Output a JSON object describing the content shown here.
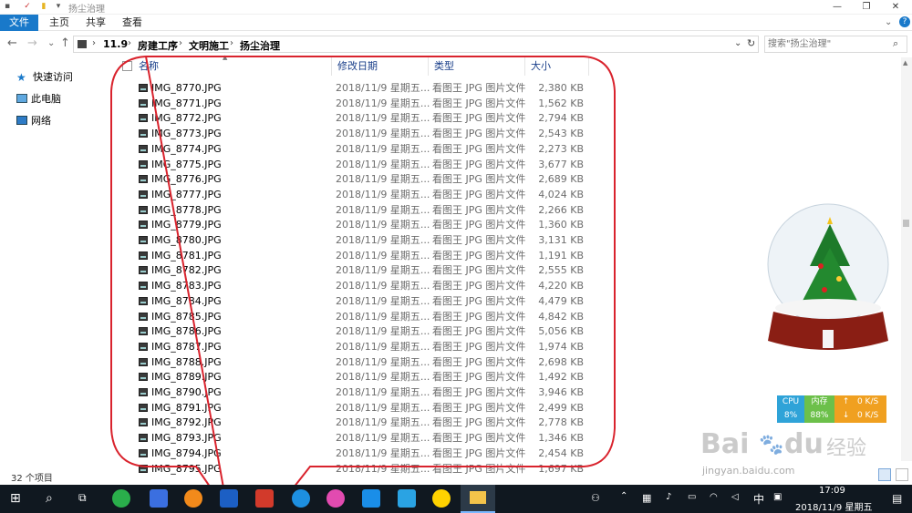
{
  "window": {
    "title": "扬尘治理",
    "minimize_glyph": "—",
    "maximize_glyph": "❐",
    "close_glyph": "✕"
  },
  "ribbon": {
    "file_label": "文件",
    "tabs": [
      "主页",
      "共享",
      "查看"
    ],
    "help_glyph": "?"
  },
  "address": {
    "crumbs": [
      "11.9",
      "房建工序",
      "文明施工",
      "扬尘治理"
    ],
    "search_placeholder": "搜索\"扬尘治理\""
  },
  "nav_pane": {
    "items": [
      {
        "label": "快速访问",
        "icon": "star-icon"
      },
      {
        "label": "此电脑",
        "icon": "computer-icon"
      },
      {
        "label": "网络",
        "icon": "network-icon"
      }
    ]
  },
  "columns": {
    "name": "名称",
    "date": "修改日期",
    "type": "类型",
    "size": "大小"
  },
  "files": [
    {
      "name": "IMG_8770.JPG",
      "date": "2018/11/9 星期五...",
      "type": "看图王 JPG 图片文件",
      "size": "2,380 KB"
    },
    {
      "name": "IMG_8771.JPG",
      "date": "2018/11/9 星期五...",
      "type": "看图王 JPG 图片文件",
      "size": "1,562 KB"
    },
    {
      "name": "IMG_8772.JPG",
      "date": "2018/11/9 星期五...",
      "type": "看图王 JPG 图片文件",
      "size": "2,794 KB"
    },
    {
      "name": "IMG_8773.JPG",
      "date": "2018/11/9 星期五...",
      "type": "看图王 JPG 图片文件",
      "size": "2,543 KB"
    },
    {
      "name": "IMG_8774.JPG",
      "date": "2018/11/9 星期五...",
      "type": "看图王 JPG 图片文件",
      "size": "2,273 KB"
    },
    {
      "name": "IMG_8775.JPG",
      "date": "2018/11/9 星期五...",
      "type": "看图王 JPG 图片文件",
      "size": "3,677 KB"
    },
    {
      "name": "IMG_8776.JPG",
      "date": "2018/11/9 星期五...",
      "type": "看图王 JPG 图片文件",
      "size": "2,689 KB"
    },
    {
      "name": "IMG_8777.JPG",
      "date": "2018/11/9 星期五...",
      "type": "看图王 JPG 图片文件",
      "size": "4,024 KB"
    },
    {
      "name": "IMG_8778.JPG",
      "date": "2018/11/9 星期五...",
      "type": "看图王 JPG 图片文件",
      "size": "2,266 KB"
    },
    {
      "name": "IMG_8779.JPG",
      "date": "2018/11/9 星期五...",
      "type": "看图王 JPG 图片文件",
      "size": "1,360 KB"
    },
    {
      "name": "IMG_8780.JPG",
      "date": "2018/11/9 星期五...",
      "type": "看图王 JPG 图片文件",
      "size": "3,131 KB"
    },
    {
      "name": "IMG_8781.JPG",
      "date": "2018/11/9 星期五...",
      "type": "看图王 JPG 图片文件",
      "size": "1,191 KB"
    },
    {
      "name": "IMG_8782.JPG",
      "date": "2018/11/9 星期五...",
      "type": "看图王 JPG 图片文件",
      "size": "2,555 KB"
    },
    {
      "name": "IMG_8783.JPG",
      "date": "2018/11/9 星期五...",
      "type": "看图王 JPG 图片文件",
      "size": "4,220 KB"
    },
    {
      "name": "IMG_8784.JPG",
      "date": "2018/11/9 星期五...",
      "type": "看图王 JPG 图片文件",
      "size": "4,479 KB"
    },
    {
      "name": "IMG_8785.JPG",
      "date": "2018/11/9 星期五...",
      "type": "看图王 JPG 图片文件",
      "size": "4,842 KB"
    },
    {
      "name": "IMG_8786.JPG",
      "date": "2018/11/9 星期五...",
      "type": "看图王 JPG 图片文件",
      "size": "5,056 KB"
    },
    {
      "name": "IMG_8787.JPG",
      "date": "2018/11/9 星期五...",
      "type": "看图王 JPG 图片文件",
      "size": "1,974 KB"
    },
    {
      "name": "IMG_8788.JPG",
      "date": "2018/11/9 星期五...",
      "type": "看图王 JPG 图片文件",
      "size": "2,698 KB"
    },
    {
      "name": "IMG_8789.JPG",
      "date": "2018/11/9 星期五...",
      "type": "看图王 JPG 图片文件",
      "size": "1,492 KB"
    },
    {
      "name": "IMG_8790.JPG",
      "date": "2018/11/9 星期五...",
      "type": "看图王 JPG 图片文件",
      "size": "3,946 KB"
    },
    {
      "name": "IMG_8791.JPG",
      "date": "2018/11/9 星期五...",
      "type": "看图王 JPG 图片文件",
      "size": "2,499 KB"
    },
    {
      "name": "IMG_8792.JPG",
      "date": "2018/11/9 星期五...",
      "type": "看图王 JPG 图片文件",
      "size": "2,778 KB"
    },
    {
      "name": "IMG_8793.JPG",
      "date": "2018/11/9 星期五...",
      "type": "看图王 JPG 图片文件",
      "size": "1,346 KB"
    },
    {
      "name": "IMG_8794.JPG",
      "date": "2018/11/9 星期五...",
      "type": "看图王 JPG 图片文件",
      "size": "2,454 KB"
    },
    {
      "name": "IMG_8795.JPG",
      "date": "2018/11/9 星期五...",
      "type": "看图王 JPG 图片文件",
      "size": "1,697 KB"
    }
  ],
  "status": {
    "item_count": "32 个项目"
  },
  "perf_widget": {
    "cpu_label": "CPU",
    "cpu_value": "8%",
    "mem_label": "内存",
    "mem_value": "88%",
    "up_arrow": "↑",
    "down_arrow": "↓",
    "up_speed": "0 K/S",
    "down_speed": "0 K/S"
  },
  "watermark": {
    "brand": "Bai",
    "brand2": "du",
    "brand_cn": "经验",
    "url": "jingyan.baidu.com"
  },
  "taskbar": {
    "ime": "中",
    "time": "17:09",
    "date": "2018/11/9 星期五"
  },
  "colors": {
    "accent": "#1979ca",
    "annotation_red": "#d9232d",
    "taskbar": "#101820"
  }
}
